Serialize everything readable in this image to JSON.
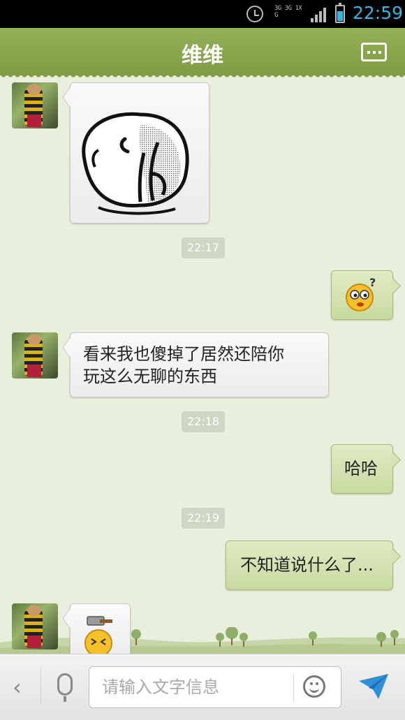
{
  "status_bar": {
    "network_text": "3G 3G 1X G",
    "time": "22:59",
    "accent_color": "#33b5e5"
  },
  "header": {
    "title": "维维",
    "menu_icon": "more-dots-icon"
  },
  "messages": [
    {
      "side": "in",
      "kind": "sticker",
      "sticker": "crying-face-sticker"
    },
    {
      "side": "time",
      "text": "22:17"
    },
    {
      "side": "out",
      "kind": "emoji",
      "emoji": "confused-question-emoji"
    },
    {
      "side": "in",
      "kind": "text",
      "lines": [
        "看来我也傻掉了居然还陪你",
        "玩这么无聊的东西"
      ]
    },
    {
      "side": "time",
      "text": "22:18"
    },
    {
      "side": "out",
      "kind": "text",
      "text": "哈哈"
    },
    {
      "side": "time",
      "text": "22:19"
    },
    {
      "side": "out",
      "kind": "text",
      "text": "不知道说什么了..."
    },
    {
      "side": "in",
      "kind": "emoji",
      "emoji": "hammer-hit-emoji"
    }
  ],
  "input_bar": {
    "placeholder": "请输入文字信息",
    "value": "",
    "icons": [
      "back-chevron-icon",
      "microphone-icon",
      "smiley-icon",
      "send-arrow-icon"
    ]
  },
  "colors": {
    "header": "#8aa64e",
    "background": "#e8efdc",
    "outgoing_bubble": "#d3e2ae",
    "incoming_bubble": "#f5f5f5"
  }
}
